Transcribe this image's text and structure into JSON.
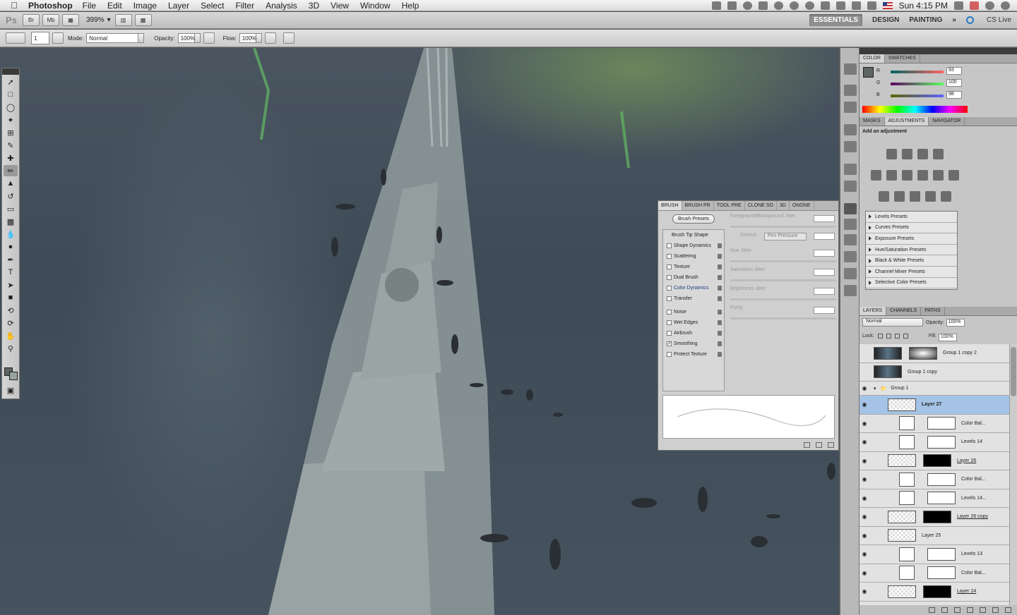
{
  "menubar": {
    "app": "Photoshop",
    "items": [
      "File",
      "Edit",
      "Image",
      "Layer",
      "Select",
      "Filter",
      "Analysis",
      "3D",
      "View",
      "Window",
      "Help"
    ],
    "clock": "Sun 4:15 PM"
  },
  "appbar": {
    "logo": "Ps",
    "bridge": "Br",
    "minibridge": "Mb",
    "zoom": "399%",
    "workspaces": [
      "ESSENTIALS",
      "DESIGN",
      "PAINTING"
    ],
    "more": "»",
    "cslive": "CS Live"
  },
  "options": {
    "brush_size": "1",
    "mode_label": "Mode:",
    "mode_value": "Normal",
    "opacity_label": "Opacity:",
    "opacity_value": "100%",
    "flow_label": "Flow:",
    "flow_value": "100%"
  },
  "brush_panel": {
    "tabs": [
      "BRUSH",
      "BRUSH PR",
      "TOOL PRE",
      "CLONE SO",
      "3D",
      "ONONE"
    ],
    "presets_button": "Brush Presets",
    "head": "Brush Tip Shape",
    "options": [
      {
        "label": "Shape Dynamics",
        "checked": false
      },
      {
        "label": "Scattering",
        "checked": false
      },
      {
        "label": "Texture",
        "checked": false
      },
      {
        "label": "Dual Brush",
        "checked": false
      },
      {
        "label": "Color Dynamics",
        "checked": false
      },
      {
        "label": "Transfer",
        "checked": false
      },
      {
        "label": "Noise",
        "checked": false
      },
      {
        "label": "Wet Edges",
        "checked": false
      },
      {
        "label": "Airbrush",
        "checked": false
      },
      {
        "label": "Smoothing",
        "checked": true
      },
      {
        "label": "Protect Texture",
        "checked": false
      }
    ],
    "controls": [
      "Foreground/Background Jitter",
      "Hue Jitter",
      "Saturation Jitter",
      "Brightness Jitter",
      "Purity"
    ],
    "control_label": "Control:",
    "control_value": "Pen Pressure"
  },
  "color_panel": {
    "tabs": [
      "COLOR",
      "SWATCHES"
    ],
    "r": "93",
    "g": "100",
    "b": "98",
    "fg_color": "#5d6462"
  },
  "adjustments_panel": {
    "tabs": [
      "MASKS",
      "ADJUSTMENTS",
      "NAVIGATOR"
    ],
    "title": "Add an adjustment",
    "presets": [
      "Levels Presets",
      "Curves Presets",
      "Exposure Presets",
      "Hue/Saturation Presets",
      "Black & White Presets",
      "Channel Mixer Presets",
      "Selective Color Presets"
    ]
  },
  "layers_panel": {
    "tabs": [
      "LAYERS",
      "CHANNELS",
      "PATHS"
    ],
    "blend": "Normal",
    "opacity_label": "Opacity:",
    "opacity_value": "100%",
    "lock_label": "Lock:",
    "fill_label": "Fill:",
    "fill_value": "100%",
    "layers": [
      {
        "name": "Group 1 copy 2",
        "kind": "dark-mask",
        "visible": false
      },
      {
        "name": "Group 1 copy",
        "kind": "dark",
        "visible": false
      },
      {
        "name": "Group 1",
        "kind": "group",
        "visible": true
      },
      {
        "name": "Layer 27",
        "kind": "pixel",
        "visible": true,
        "selected": true
      },
      {
        "name": "Color Bal...",
        "kind": "adj",
        "visible": true
      },
      {
        "name": "Levels 14",
        "kind": "adj",
        "visible": true
      },
      {
        "name": "Layer 26",
        "kind": "pixel-mask",
        "visible": true
      },
      {
        "name": "Color Bal...",
        "kind": "adj",
        "visible": true
      },
      {
        "name": "Levels 14...",
        "kind": "adj",
        "visible": true
      },
      {
        "name": "Layer 26 copy",
        "kind": "pixel-mask",
        "visible": true
      },
      {
        "name": "Layer 25",
        "kind": "pixel",
        "visible": true
      },
      {
        "name": "Levels 13",
        "kind": "adj",
        "visible": true
      },
      {
        "name": "Color Bal...",
        "kind": "adj",
        "visible": true
      },
      {
        "name": "Layer 24",
        "kind": "pixel-mask",
        "visible": true
      }
    ]
  }
}
